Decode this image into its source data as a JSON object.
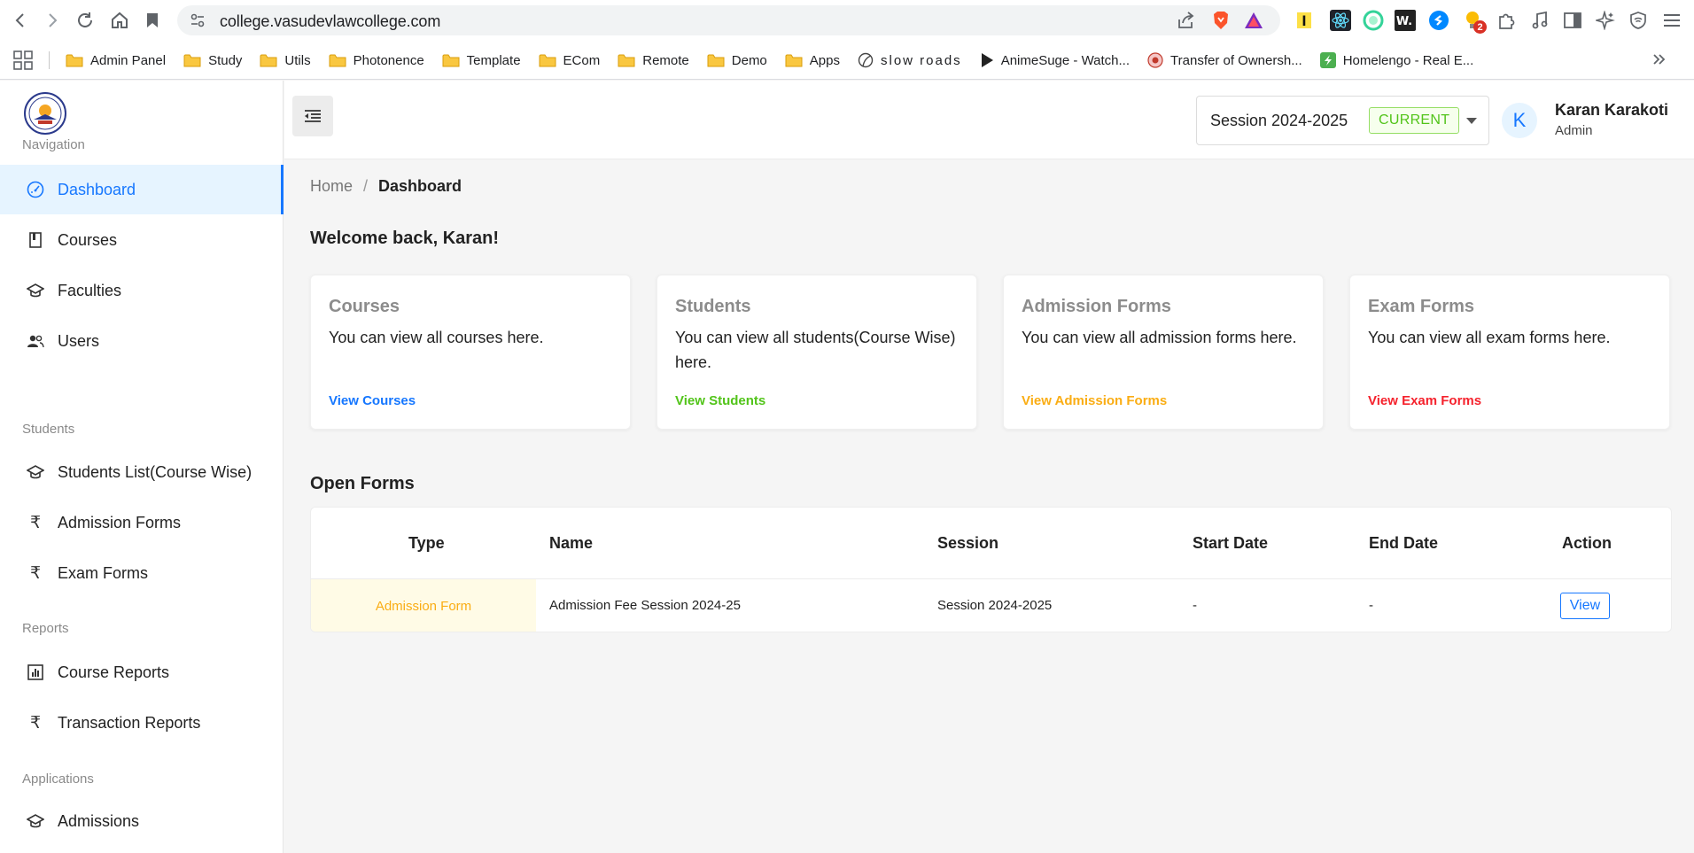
{
  "browser": {
    "url": "college.vasudevlawcollege.com",
    "extension_badge": "2",
    "bookmarks": [
      {
        "label": "Admin Panel",
        "icon": "folder-icon"
      },
      {
        "label": "Study",
        "icon": "folder-icon"
      },
      {
        "label": "Utils",
        "icon": "folder-icon"
      },
      {
        "label": "Photonence",
        "icon": "folder-icon"
      },
      {
        "label": "Template",
        "icon": "folder-icon"
      },
      {
        "label": "ECom",
        "icon": "folder-icon"
      },
      {
        "label": "Remote",
        "icon": "folder-icon"
      },
      {
        "label": "Demo",
        "icon": "folder-icon"
      },
      {
        "label": "Apps",
        "icon": "folder-icon"
      },
      {
        "label": "slow roads",
        "icon": "slow-roads-icon"
      },
      {
        "label": "AnimeSuge - Watch...",
        "icon": "play-icon"
      },
      {
        "label": "Transfer of Ownersh...",
        "icon": "seal-icon"
      },
      {
        "label": "Homelengo - Real E...",
        "icon": "homelengo-icon"
      }
    ]
  },
  "sidebar": {
    "sections": {
      "navigation": "Navigation",
      "students": "Students",
      "reports": "Reports",
      "applications": "Applications"
    },
    "items": {
      "dashboard": "Dashboard",
      "courses": "Courses",
      "faculties": "Faculties",
      "users": "Users",
      "students_list": "Students List(Course Wise)",
      "admission_forms": "Admission Forms",
      "exam_forms": "Exam Forms",
      "course_reports": "Course Reports",
      "transaction_reports": "Transaction Reports",
      "admissions": "Admissions"
    },
    "rupee_symbol": "₹"
  },
  "header": {
    "session_label": "Session 2024-2025",
    "session_tag": "CURRENT",
    "avatar_letter": "K",
    "user_name": "Karan Karakoti",
    "user_role": "Admin"
  },
  "breadcrumb": {
    "home": "Home",
    "separator": "/",
    "current": "Dashboard"
  },
  "welcome": "Welcome back, Karan!",
  "cards": [
    {
      "title": "Courses",
      "desc": "You can view all courses here.",
      "link": "View Courses",
      "color": "#1677ff"
    },
    {
      "title": "Students",
      "desc": "You can view all students(Course Wise) here.",
      "link": "View Students",
      "color": "#52c41a"
    },
    {
      "title": "Admission Forms",
      "desc": "You can view all admission forms here.",
      "link": "View Admission Forms",
      "color": "#faad14"
    },
    {
      "title": "Exam Forms",
      "desc": "You can view all exam forms here.",
      "link": "View Exam Forms",
      "color": "#f5222d"
    }
  ],
  "open_forms": {
    "title": "Open Forms",
    "columns": [
      "Type",
      "Name",
      "Session",
      "Start Date",
      "End Date",
      "Action"
    ],
    "rows": [
      {
        "type": "Admission Form",
        "name": "Admission Fee Session 2024-25",
        "session": "Session 2024-2025",
        "start_date": "-",
        "end_date": "-",
        "action": "View"
      }
    ]
  },
  "colors": {
    "primary": "#1677ff",
    "success": "#52c41a",
    "warning": "#faad14",
    "danger": "#f5222d"
  }
}
